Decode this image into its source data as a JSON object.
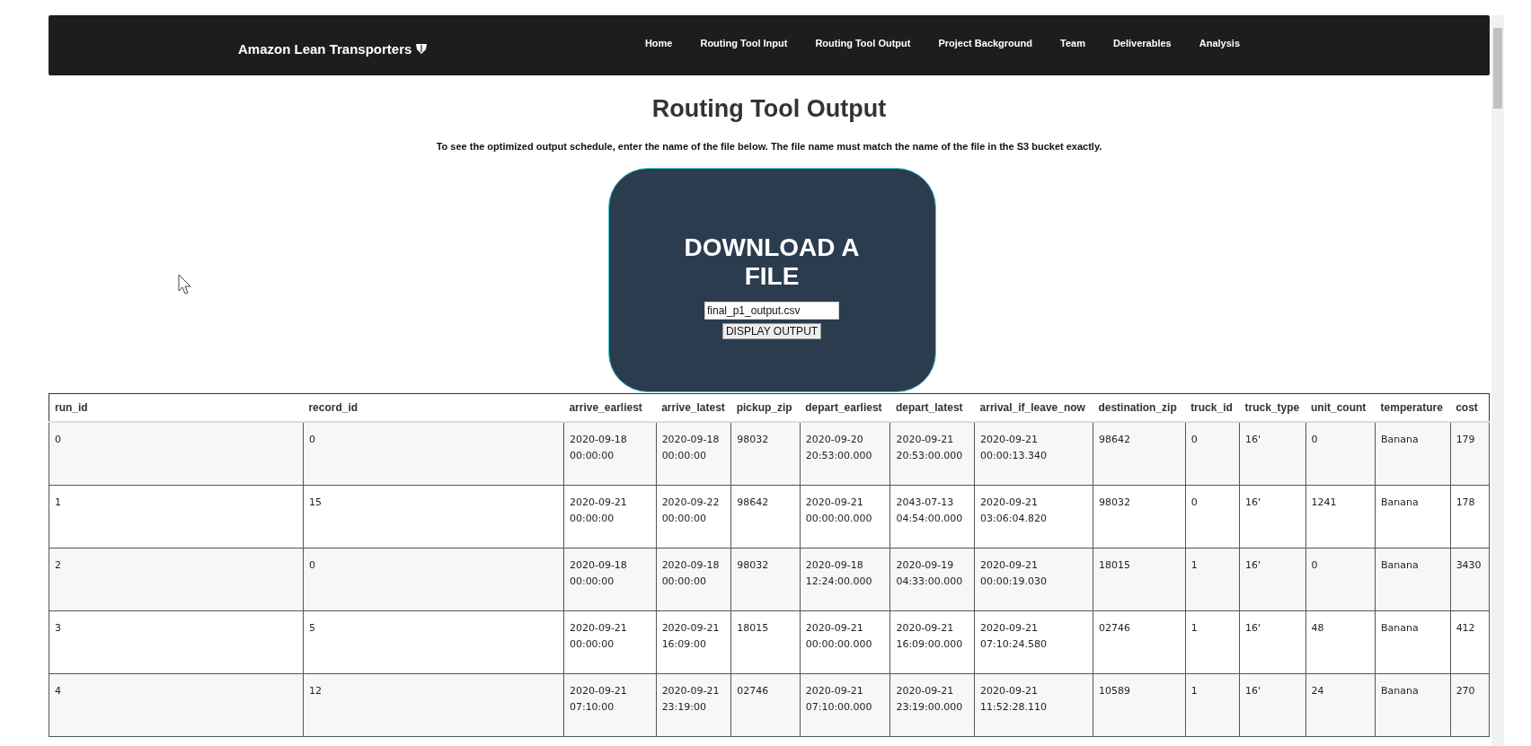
{
  "navbar": {
    "brand": "Amazon Lean Transporters",
    "links": [
      {
        "label": "Home",
        "selected": false
      },
      {
        "label": "Routing Tool Input",
        "selected": false
      },
      {
        "label": "Routing Tool Output",
        "selected": false
      },
      {
        "label": "Project Background",
        "selected": false
      },
      {
        "label": "Team",
        "selected": false
      },
      {
        "label": "Deliverables",
        "selected": false
      },
      {
        "label": "Analysis",
        "selected": false
      }
    ]
  },
  "page": {
    "title": "Routing Tool Output",
    "instructions": "To see the optimized output schedule, enter the name of the file below. The file name must match the name of the file in the S3 bucket exactly."
  },
  "download_card": {
    "title": "DOWNLOAD A FILE",
    "file_input": {
      "value": "final_p1_output.csv"
    },
    "button": "DISPLAY OUTPUT"
  },
  "table": {
    "columns": [
      "run_id",
      "record_id",
      "arrive_earliest",
      "arrive_latest",
      "pickup_zip",
      "depart_earliest",
      "depart_latest",
      "arrival_if_leave_now",
      "destination_zip",
      "truck_id",
      "truck_type",
      "unit_count",
      "temperature",
      "cost"
    ],
    "rows": [
      [
        "0",
        "0",
        "2020-09-18 00:00:00",
        "2020-09-18 00:00:00",
        "98032",
        "2020-09-20 20:53:00.000",
        "2020-09-21 20:53:00.000",
        "2020-09-21 00:00:13.340",
        "98642",
        "0",
        "16'",
        "0",
        "Banana",
        "179"
      ],
      [
        "1",
        "15",
        "2020-09-21 00:00:00",
        "2020-09-22 00:00:00",
        "98642",
        "2020-09-21 00:00:00.000",
        "2043-07-13 04:54:00.000",
        "2020-09-21 03:06:04.820",
        "98032",
        "0",
        "16'",
        "1241",
        "Banana",
        "178"
      ],
      [
        "2",
        "0",
        "2020-09-18 00:00:00",
        "2020-09-18 00:00:00",
        "98032",
        "2020-09-18 12:24:00.000",
        "2020-09-19 04:33:00.000",
        "2020-09-21 00:00:19.030",
        "18015",
        "1",
        "16'",
        "0",
        "Banana",
        "3430"
      ],
      [
        "3",
        "5",
        "2020-09-21 00:00:00",
        "2020-09-21 16:09:00",
        "18015",
        "2020-09-21 00:00:00.000",
        "2020-09-21 16:09:00.000",
        "2020-09-21 07:10:24.580",
        "02746",
        "1",
        "16'",
        "48",
        "Banana",
        "412"
      ],
      [
        "4",
        "12",
        "2020-09-21 07:10:00",
        "2020-09-21 23:19:00",
        "02746",
        "2020-09-21 07:10:00.000",
        "2020-09-21 23:19:00.000",
        "2020-09-21 11:52:28.110",
        "10589",
        "1",
        "16'",
        "24",
        "Banana",
        "270"
      ]
    ]
  }
}
